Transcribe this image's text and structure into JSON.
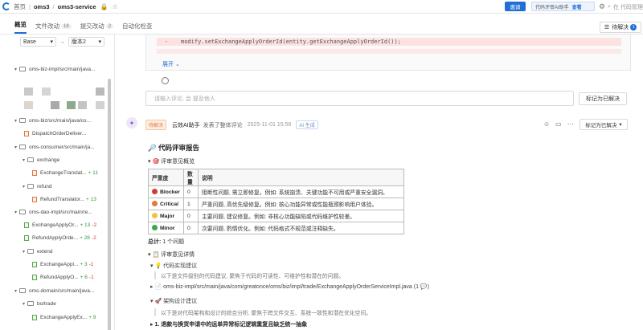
{
  "topbar": {
    "breadcrumb": [
      "首页",
      "oms3",
      "oms3-service"
    ],
    "invite_label": "邀请",
    "ai_assistant_label": "代码评审AI助手",
    "ai_view_label": "查看",
    "search_placeholder": "在 代码管理"
  },
  "tabs": [
    {
      "label": "概览",
      "count": ""
    },
    {
      "label": "文件改动",
      "count": "18"
    },
    {
      "label": "提交改动",
      "count": "2"
    },
    {
      "label": "自动化检查",
      "count": ""
    }
  ],
  "pending": {
    "label": "待解决",
    "count": "1"
  },
  "sidebar": {
    "base_label": "Base",
    "target_label": "版本2",
    "rows": [
      {
        "kind": "folder",
        "label": "oms-biz-impl/src/main/java...",
        "add": "",
        "del": ""
      },
      {
        "kind": "folder",
        "label": "oms-biz/src/main/java/co...",
        "add": "",
        "del": ""
      },
      {
        "kind": "file",
        "label": "DispatchOrderDeliver...",
        "add": "",
        "del": ""
      },
      {
        "kind": "folder",
        "label": "oms-consumer/src/main/ja...",
        "add": "",
        "del": ""
      },
      {
        "kind": "folder",
        "label": "exchange",
        "add": "",
        "del": ""
      },
      {
        "kind": "file",
        "label": "ExchangeTranslat...",
        "add": "+ 11",
        "del": ""
      },
      {
        "kind": "folder",
        "label": "refund",
        "add": "",
        "del": ""
      },
      {
        "kind": "file",
        "label": "RefundTranslator...",
        "add": "+ 13",
        "del": ""
      },
      {
        "kind": "folder",
        "label": "oms-dao-impl/src/main/re...",
        "add": "",
        "del": ""
      },
      {
        "kind": "file",
        "label": "ExchangeApplyOr...",
        "add": "+ 13",
        "del": "-2"
      },
      {
        "kind": "file",
        "label": "RefundApplyOrde...",
        "add": "+ 28",
        "del": "-2"
      },
      {
        "kind": "folder",
        "label": "extend",
        "add": "",
        "del": ""
      },
      {
        "kind": "file",
        "label": "ExchangeAppl...",
        "add": "+ 3",
        "del": "-1"
      },
      {
        "kind": "file",
        "label": "RefundApplyO...",
        "add": "+ 6",
        "del": "-1"
      },
      {
        "kind": "folder",
        "label": "oms-domain/src/main/java...",
        "add": "",
        "del": ""
      },
      {
        "kind": "folder",
        "label": "bo/trade",
        "add": "",
        "del": ""
      },
      {
        "kind": "file",
        "label": "ExchangeApplyEx...",
        "add": "+ 9",
        "del": ""
      }
    ]
  },
  "code": {
    "diff_line_1": "modify.setExchangeApplyOrderId(entity.getExchangeApplyOrderId());",
    "expand_label": "展开"
  },
  "comment_input": {
    "placeholder": "请输入评论, 会 提及他人",
    "resolve_label": "标记为已解决"
  },
  "review": {
    "status_tag": "待解决",
    "author": "云效AI助手",
    "action": "发表了整体评论",
    "time": "2025-11-01 15:56",
    "ai_tag": "AI 生成",
    "resolve_label": "标记为已解决",
    "title": "代码评审报告",
    "overview_title": "评审意见概览",
    "table_headers": [
      "严重度",
      "数量",
      "说明"
    ],
    "table_rows": [
      {
        "severity": "Blocker",
        "color": "#d63a3a",
        "count": "0",
        "desc": "阻断性问题, 需立即修复。例如: 系统崩溃、关键功能不可用或严重安全漏洞。"
      },
      {
        "severity": "Critical",
        "color": "#e07a3c",
        "count": "1",
        "desc": "严重问题, 高优先级修复。例如: 核心功能异常或性能瓶颈影响用户体验。"
      },
      {
        "severity": "Major",
        "color": "#f0c33c",
        "count": "0",
        "desc": "主要问题, 建议修复。例如: 非核心功能缺陷或代码维护性较差。"
      },
      {
        "severity": "Minor",
        "color": "#3aa84d",
        "count": "0",
        "desc": "次要问题, 酌情优化。例如: 代码格式不规范或注释缺失。"
      }
    ],
    "total_label": "总计:",
    "total_value": "1 个问题",
    "details_title": "评审意见详情",
    "impl_title": "代码实现建议",
    "impl_note": "以下是文件级别的代码建议, 聚焦于代码的可读性、可维护性和潜在的问题。",
    "file_path": "oms-biz-impl/src/main/java/com/greatonce/oms/biz/impl/trade/ExchangeApplyOrderServiceImpl.java (1 💬)",
    "arch_title": "架构设计建议",
    "arch_note": "以下是对代码架构和设计的综合分析, 聚焦于跨文件交互、系统一致性和潜在优化空间。",
    "issue_1": "1. 退款与换货申请中的运单异常标记逻辑重复且缺乏统一抽象"
  }
}
